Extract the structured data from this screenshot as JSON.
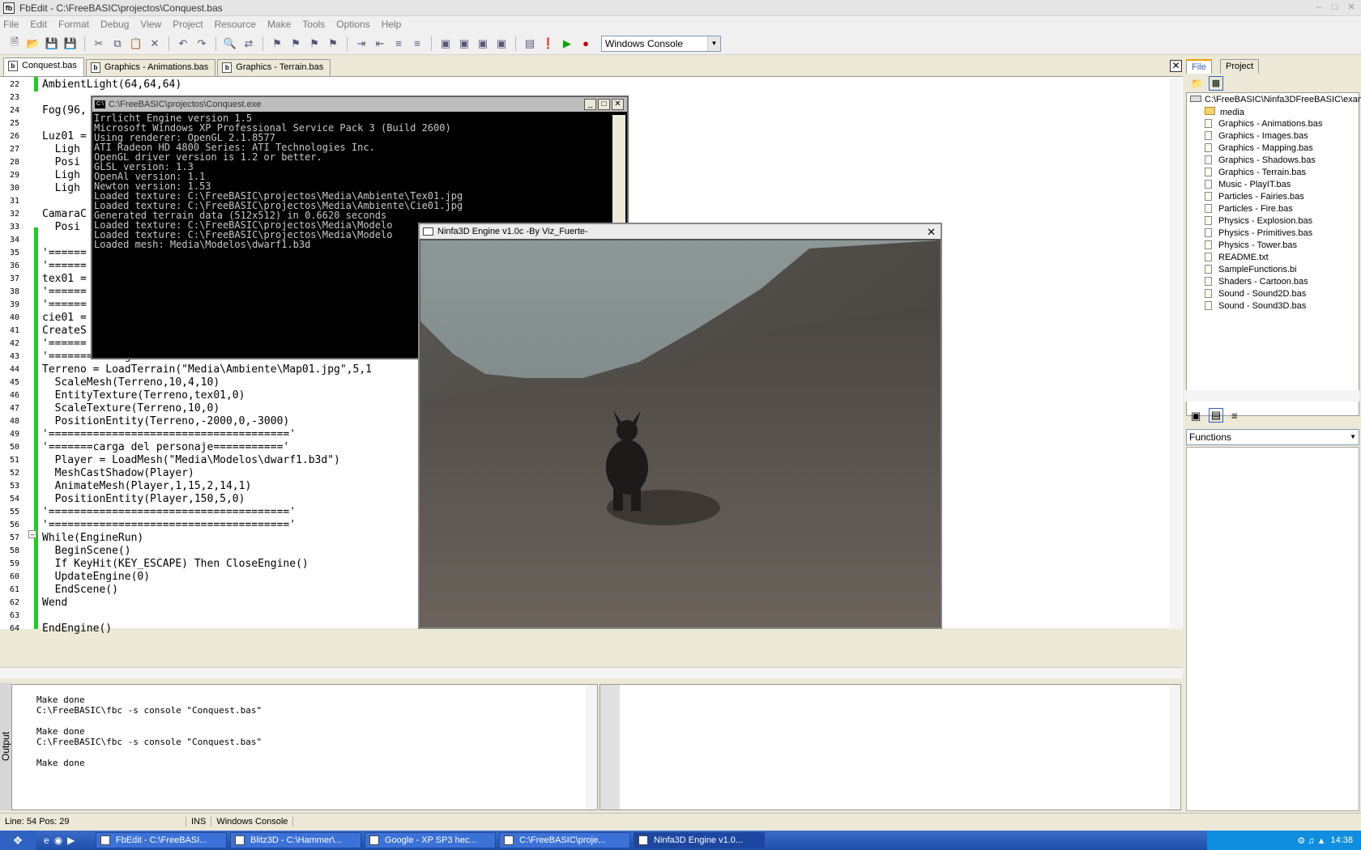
{
  "window": {
    "title": "FbEdit - C:\\FreeBASIC\\projectos\\Conquest.bas",
    "icon_text": "fb"
  },
  "menu": [
    "File",
    "Edit",
    "Format",
    "Debug",
    "View",
    "Project",
    "Resource",
    "Make",
    "Tools",
    "Options",
    "Help"
  ],
  "toolbar": {
    "build_option": "Windows Console"
  },
  "tabs": [
    {
      "label": "Conquest.bas"
    },
    {
      "label": "Graphics - Animations.bas"
    },
    {
      "label": "Graphics - Terrain.bas"
    }
  ],
  "editor": {
    "lines": [
      {
        "n": "22",
        "t": "AmbientLight(64,64,64)"
      },
      {
        "n": "23",
        "t": ""
      },
      {
        "n": "24",
        "t": "Fog(96,"
      },
      {
        "n": "25",
        "t": ""
      },
      {
        "n": "26",
        "t": "Luz01 ="
      },
      {
        "n": "27",
        "t": "  Ligh"
      },
      {
        "n": "28",
        "t": "  Posi"
      },
      {
        "n": "29",
        "t": "  Ligh"
      },
      {
        "n": "30",
        "t": "  Ligh"
      },
      {
        "n": "31",
        "t": ""
      },
      {
        "n": "32",
        "t": "CamaraC"
      },
      {
        "n": "33",
        "t": "  Posi"
      },
      {
        "n": "34",
        "t": ""
      },
      {
        "n": "35",
        "t": "'======"
      },
      {
        "n": "36",
        "t": "'======"
      },
      {
        "n": "37",
        "t": "tex01 ="
      },
      {
        "n": "38",
        "t": "'======"
      },
      {
        "n": "39",
        "t": "'======"
      },
      {
        "n": "40",
        "t": "cie01 ="
      },
      {
        "n": "41",
        "t": "CreateS"
      },
      {
        "n": "42",
        "t": "'======"
      },
      {
        "n": "43",
        "t": "'=========carga de terreno==========='"
      },
      {
        "n": "44",
        "t": "Terreno = LoadTerrain(\"Media\\Ambiente\\Map01.jpg\",5,1"
      },
      {
        "n": "45",
        "t": "  ScaleMesh(Terreno,10,4,10)"
      },
      {
        "n": "46",
        "t": "  EntityTexture(Terreno,tex01,0)"
      },
      {
        "n": "47",
        "t": "  ScaleTexture(Terreno,10,0)"
      },
      {
        "n": "48",
        "t": "  PositionEntity(Terreno,-2000,0,-3000)"
      },
      {
        "n": "49",
        "t": "'======================================'"
      },
      {
        "n": "50",
        "t": "'=======carga del personaje==========='"
      },
      {
        "n": "51",
        "t": "  Player = LoadMesh(\"Media\\Modelos\\dwarf1.b3d\")"
      },
      {
        "n": "52",
        "t": "  MeshCastShadow(Player)"
      },
      {
        "n": "53",
        "t": "  AnimateMesh(Player,1,15,2,14,1)"
      },
      {
        "n": "54",
        "t": "  PositionEntity(Player,150,5,0)"
      },
      {
        "n": "55",
        "t": "'======================================'"
      },
      {
        "n": "56",
        "t": "'======================================'"
      },
      {
        "n": "57",
        "t": "While(EngineRun)"
      },
      {
        "n": "58",
        "t": "  BeginScene()"
      },
      {
        "n": "59",
        "t": "  If KeyHit(KEY_ESCAPE) Then CloseEngine()"
      },
      {
        "n": "60",
        "t": "  UpdateEngine(0)"
      },
      {
        "n": "61",
        "t": "  EndScene()"
      },
      {
        "n": "62",
        "t": "Wend"
      },
      {
        "n": "63",
        "t": ""
      },
      {
        "n": "64",
        "t": "EndEngine()"
      }
    ]
  },
  "console": {
    "title": "C:\\FreeBASIC\\projectos\\Conquest.exe",
    "lines": [
      "Irrlicht Engine version 1.5",
      "Microsoft Windows XP Professional Service Pack 3 (Build 2600)",
      "Using renderer: OpenGL 2.1.8577",
      "ATI Radeon HD 4800 Series: ATI Technologies Inc.",
      "OpenGL driver version is 1.2 or better.",
      "GLSL version: 1.3",
      "OpenAl version: 1.1",
      "Newton version: 1.53",
      "Loaded texture: C:\\FreeBASIC\\projectos\\Media\\Ambiente\\Tex01.jpg",
      "Loaded texture: C:\\FreeBASIC\\projectos\\Media\\Ambiente\\Cie01.jpg",
      "Generated terrain data (512x512) in 0.6620 seconds",
      "Loaded texture: C:\\FreeBASIC\\projectos\\Media\\Modelo",
      "Loaded texture: C:\\FreeBASIC\\projectos\\Media\\Modelo",
      "Loaded mesh: Media\\Modelos\\dwarf1.b3d"
    ]
  },
  "engine_window": {
    "title": "Ninfa3D Engine v1.0c -By Viz_Fuerte-"
  },
  "right_panel": {
    "tabs": [
      "File",
      "Project"
    ],
    "root": "C:\\FreeBASIC\\Ninfa3DFreeBASIC\\exam",
    "folder": "media",
    "files": [
      "Graphics - Animations.bas",
      "Graphics - Images.bas",
      "Graphics - Mapping.bas",
      "Graphics - Shadows.bas",
      "Graphics - Terrain.bas",
      "Music - PlayIT.bas",
      "Particles - Fairies.bas",
      "Particles - Fire.bas",
      "Physics - Explosion.bas",
      "Physics - Primitives.bas",
      "Physics - Tower.bas",
      "README.txt",
      "SampleFunctions.bi",
      "Shaders - Cartoon.bas",
      "Sound - Sound2D.bas",
      "Sound - Sound3D.bas"
    ],
    "functions_label": "Functions"
  },
  "output": {
    "label": "Output",
    "lines": [
      "Make done",
      "C:\\FreeBASIC\\fbc -s console \"Conquest.bas\"",
      "",
      "Make done",
      "C:\\FreeBASIC\\fbc -s console \"Conquest.bas\"",
      "",
      "Make done"
    ]
  },
  "status": {
    "position": "Line: 54 Pos: 29",
    "mode": "INS",
    "build": "Windows Console"
  },
  "taskbar": {
    "buttons": [
      "FbEdit - C:\\FreeBASI...",
      "Blitz3D - C:\\Hammer\\...",
      "Google - XP SP3 hec...",
      "C:\\FreeBASIC\\proje...",
      "Ninfa3D Engine v1.0..."
    ],
    "clock": "14:38"
  }
}
